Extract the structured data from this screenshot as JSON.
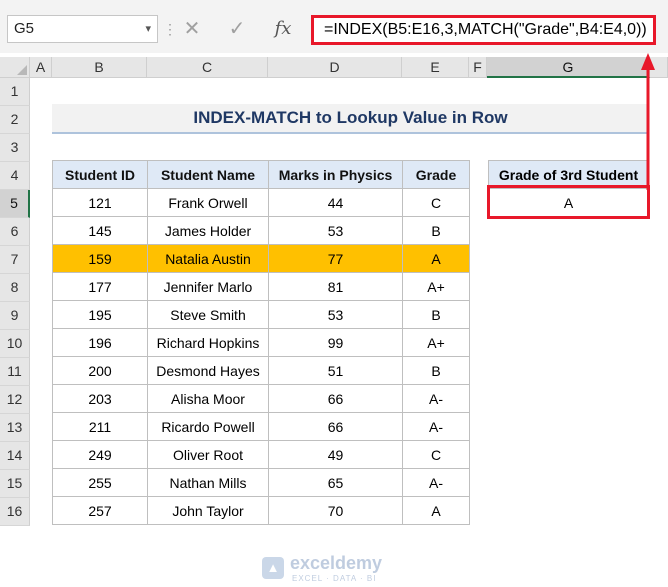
{
  "name_box": {
    "value": "G5"
  },
  "formula_bar": {
    "cancel_icon": "✕",
    "enter_icon": "✓",
    "fx_label": "fx",
    "formula": "=INDEX(B5:E16,3,MATCH(\"Grade\",B4:E4,0))"
  },
  "columns": [
    "A",
    "B",
    "C",
    "D",
    "E",
    "F",
    "G"
  ],
  "selected_column": "G",
  "rows": [
    "1",
    "2",
    "3",
    "4",
    "5",
    "6",
    "7",
    "8",
    "9",
    "10",
    "11",
    "12",
    "13",
    "14",
    "15",
    "16"
  ],
  "selected_row": "5",
  "title": "INDEX-MATCH to Lookup Value in Row",
  "table": {
    "headers": [
      "Student ID",
      "Student Name",
      "Marks in Physics",
      "Grade"
    ],
    "rows": [
      [
        "121",
        "Frank Orwell",
        "44",
        "C"
      ],
      [
        "145",
        "James Holder",
        "53",
        "B"
      ],
      [
        "159",
        "Natalia Austin",
        "77",
        "A"
      ],
      [
        "177",
        "Jennifer Marlo",
        "81",
        "A+"
      ],
      [
        "195",
        "Steve Smith",
        "53",
        "B"
      ],
      [
        "196",
        "Richard Hopkins",
        "99",
        "A+"
      ],
      [
        "200",
        "Desmond Hayes",
        "51",
        "B"
      ],
      [
        "203",
        "Alisha Moor",
        "66",
        "A-"
      ],
      [
        "211",
        "Ricardo Powell",
        "66",
        "A-"
      ],
      [
        "249",
        "Oliver Root",
        "49",
        "C"
      ],
      [
        "255",
        "Nathan Mills",
        "65",
        "A-"
      ],
      [
        "257",
        "John Taylor",
        "70",
        "A"
      ]
    ],
    "highlight_row_index": 2
  },
  "result": {
    "header": "Grade of 3rd Student",
    "value": "A"
  },
  "watermark": {
    "name": "exceldemy",
    "tagline": "EXCEL · DATA · BI"
  },
  "colors": {
    "highlight": "#ffc000",
    "header_fill": "#dfe9f6",
    "title_text": "#1f3864",
    "callout": "#e8182a",
    "excel_green": "#217346"
  }
}
